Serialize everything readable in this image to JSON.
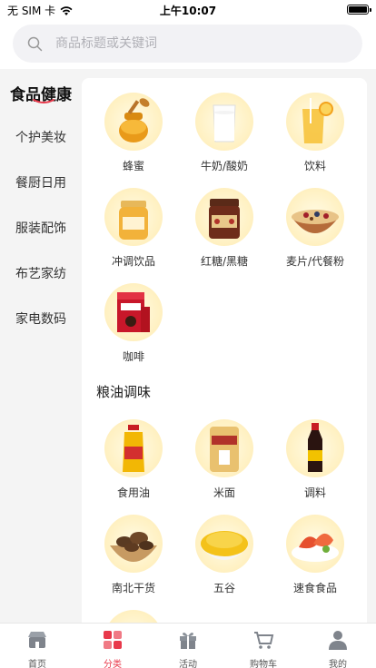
{
  "status": {
    "carrier": "无 SIM 卡",
    "time": "上午10:07",
    "battery_level": 1.0
  },
  "search": {
    "placeholder": "商品标题或关键词",
    "icon": "search-icon"
  },
  "sidebar": {
    "items": [
      {
        "label": "食品健康",
        "active": true
      },
      {
        "label": "个护美妆",
        "active": false
      },
      {
        "label": "餐厨日用",
        "active": false
      },
      {
        "label": "服装配饰",
        "active": false
      },
      {
        "label": "布艺家纺",
        "active": false
      },
      {
        "label": "家电数码",
        "active": false
      }
    ]
  },
  "sections": [
    {
      "title": "",
      "products": [
        {
          "label": "蜂蜜",
          "icon": "honey-jar-icon"
        },
        {
          "label": "牛奶/酸奶",
          "icon": "milk-glass-icon"
        },
        {
          "label": "饮料",
          "icon": "drink-glass-icon"
        },
        {
          "label": "冲调饮品",
          "icon": "jar-drink-icon"
        },
        {
          "label": "红糖/黑糖",
          "icon": "brown-sugar-icon"
        },
        {
          "label": "麦片/代餐粉",
          "icon": "cereal-bowl-icon"
        },
        {
          "label": "咖啡",
          "icon": "coffee-box-icon"
        }
      ]
    },
    {
      "title": "粮油调味",
      "products": [
        {
          "label": "食用油",
          "icon": "oil-bottle-icon"
        },
        {
          "label": "米面",
          "icon": "rice-bag-icon"
        },
        {
          "label": "调料",
          "icon": "soy-sauce-icon"
        },
        {
          "label": "南北干货",
          "icon": "mushroom-bowl-icon"
        },
        {
          "label": "五谷",
          "icon": "grain-bowl-icon"
        },
        {
          "label": "速食食品",
          "icon": "seafood-plate-icon"
        }
      ]
    }
  ],
  "tabbar": {
    "items": [
      {
        "label": "首页",
        "icon": "home-store-icon",
        "active": false
      },
      {
        "label": "分类",
        "icon": "category-grid-icon",
        "active": true
      },
      {
        "label": "活动",
        "icon": "gift-icon",
        "active": false
      },
      {
        "label": "购物车",
        "icon": "cart-icon",
        "active": false
      },
      {
        "label": "我的",
        "icon": "user-icon",
        "active": false
      }
    ]
  },
  "colors": {
    "accent": "#e8394b",
    "text": "#333333",
    "background": "#f4f4f4",
    "circle": "#fff0c0"
  }
}
